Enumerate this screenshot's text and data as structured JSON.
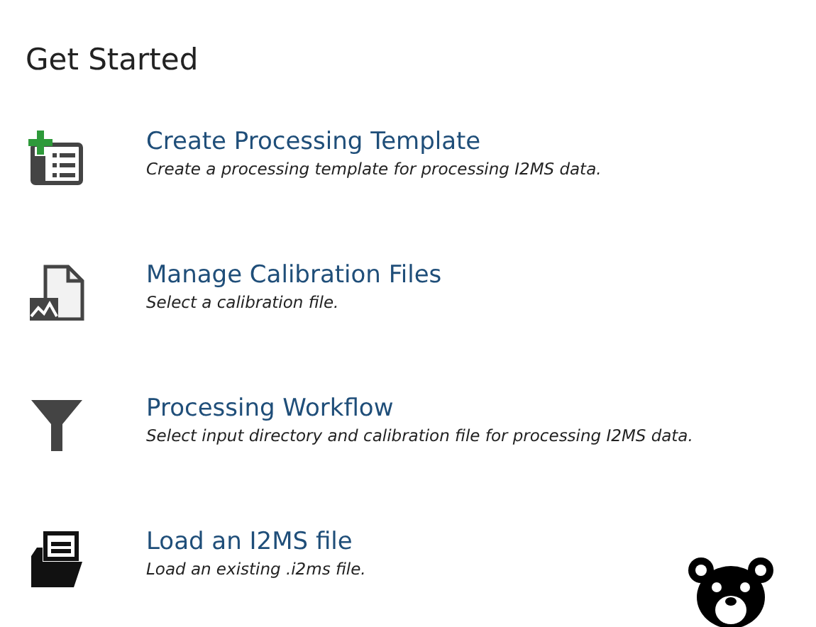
{
  "title": "Get Started",
  "items": [
    {
      "kind": "template",
      "heading": "Create Processing Template",
      "description": "Create a processing template for processing I2MS data."
    },
    {
      "kind": "calibration",
      "heading": "Manage Calibration Files",
      "description": "Select a calibration file."
    },
    {
      "kind": "workflow",
      "heading": "Processing Workflow",
      "description": "Select input directory and calibration file for processing I2MS data."
    },
    {
      "kind": "load",
      "heading": "Load an I2MS file",
      "description": "Load an existing .i2ms file."
    }
  ]
}
